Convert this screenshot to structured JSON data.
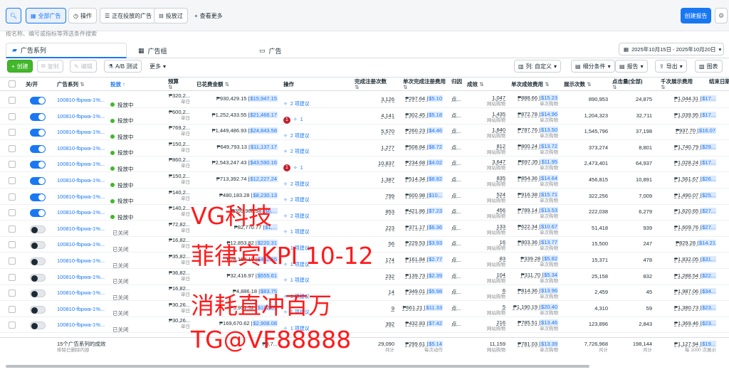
{
  "topbar": {
    "search_icon": "search-icon",
    "all_ads": "全部广告",
    "actions": "操作",
    "active_ads": "正在投放的广告",
    "delivered": "投放过",
    "more_views": "查看更多",
    "create_report": "创建报告"
  },
  "search": {
    "placeholder": "按名称、编号或指标等筛选条件搜索"
  },
  "tabs": {
    "campaigns": "广告系列",
    "adsets": "广告组",
    "ads": "广告"
  },
  "date_range": "2025年10月15日 - 2025年10月20日",
  "actions": {
    "create": "创建",
    "duplicate": "复制",
    "edit": "编辑",
    "ab_test": "A/B 测试",
    "more": "更多",
    "columns": "列: 自定义",
    "breakdown": "细分条件",
    "reports": "报告",
    "export": "导出",
    "charts": "图表"
  },
  "headers": {
    "onoff": "关/开",
    "campaign": "广告系列",
    "delivery": "投放",
    "budget": "预算",
    "spent": "已花费金额",
    "ops": "操作",
    "registrations": "完成注册次数",
    "cost_per_reg": "单次完成注册费用",
    "date": "归因",
    "results": "成效",
    "cost_per_result": "单次成效费用",
    "impressions": "展示次数",
    "clicks": "点击量(全部)",
    "cpm": "千次展示费用",
    "end": "结束日期"
  },
  "rows": [
    {
      "on": true,
      "name": "100810-fbpwa-1%...",
      "status": "投放中",
      "budget": "₱320,2...",
      "spent": "₱930,429.15 |",
      "spent_usd": "$15,947.15",
      "ops": "2 项建议",
      "badge": "",
      "reg": "3,126",
      "cpr": "₱297.64 |",
      "cpr_usd": "$5.10",
      "dt": "点...",
      "res": "1,047",
      "cpres": "₱888.66 |",
      "cpres_usd": "$15.23",
      "imp": "890,953",
      "clk": "24,875",
      "cpm": "₱1,044.31 |",
      "cpm_usd": "$17..."
    },
    {
      "on": true,
      "name": "100810-fbpwa-1%...",
      "status": "投放中",
      "budget": "₱600,2...",
      "spent": "₱1,252,433.55 |",
      "spent_usd": "$21,466.17",
      "ops": "1",
      "badge": "1",
      "reg": "4,141",
      "cpr": "₱302.45 |",
      "cpr_usd": "$5.18",
      "dt": "点...",
      "res": "1,435",
      "cpres": "₱872.78 |",
      "cpres_usd": "$14.96",
      "imp": "1,204,323",
      "clk": "32,711",
      "cpm": "₱1,039.95 |",
      "cpm_usd": "$17..."
    },
    {
      "on": true,
      "name": "100810-fbpwa-1%...",
      "status": "投放中",
      "budget": "₱769,2...",
      "spent": "₱1,449,486.93 |",
      "spent_usd": "$24,843.58",
      "ops": "2 项建议",
      "badge": "",
      "reg": "5,570",
      "cpr": "₱260.23 |",
      "cpr_usd": "$4.46",
      "dt": "点...",
      "res": "1,840",
      "cpres": "₱787.76 |",
      "cpres_usd": "$13.50",
      "imp": "1,545,796",
      "clk": "37,198",
      "cpm": "₱937.70 |",
      "cpm_usd": "$16.07"
    },
    {
      "on": true,
      "name": "100810-fbpwa-1%...",
      "status": "投放中",
      "budget": "₱150,2...",
      "spent": "₱649,793.13 |",
      "spent_usd": "$11,137.17",
      "ops": "2 项建议",
      "badge": "",
      "reg": "1,277",
      "cpr": "₱508.84 |",
      "cpr_usd": "$8.72",
      "dt": "点...",
      "res": "812",
      "cpres": "₱800.24 |",
      "cpres_usd": "$13.72",
      "imp": "373,274",
      "clk": "8,801",
      "cpm": "₱1,740.79 |",
      "cpm_usd": "$29..."
    },
    {
      "on": true,
      "name": "100810-fbpwa-1%...",
      "status": "投放中",
      "budget": "₱860,2...",
      "spent": "₱2,543,247.43 |",
      "spent_usd": "$43,590.16",
      "ops": "1",
      "badge": "1",
      "reg": "10,837",
      "cpr": "₱234.68 |",
      "cpr_usd": "$4.02",
      "dt": "点...",
      "res": "3,647",
      "cpres": "₱697.35 |",
      "cpres_usd": "$11.95",
      "imp": "2,473,401",
      "clk": "64,937",
      "cpm": "₱1,028.24 |",
      "cpm_usd": "$17..."
    },
    {
      "on": true,
      "name": "100810-fbpwa-1%...",
      "status": "投放中",
      "budget": "₱150,2...",
      "spent": "₱713,392.74 |",
      "spent_usd": "$12,227.24",
      "ops": "2 项建议",
      "badge": "",
      "reg": "1,387",
      "cpr": "₱514.34 |",
      "cpr_usd": "$8.82",
      "dt": "点...",
      "res": "835",
      "cpres": "₱854.36 |",
      "cpres_usd": "$14.64",
      "imp": "456,815",
      "clk": "10,891",
      "cpm": "₱1,561.67 |",
      "cpm_usd": "$26..."
    },
    {
      "on": true,
      "name": "100810-fbpwa-1%...",
      "status": "投放中",
      "budget": "₱140,2...",
      "spent": "₱480,183.28 |",
      "spent_usd": "$8,230.13",
      "ops": "2 项建议",
      "badge": "",
      "reg": "799",
      "cpr": "₱600.98 |",
      "cpr_usd": "$10...",
      "dt": "点...",
      "res": "524",
      "cpres": "₱916.38 |",
      "cpres_usd": "$15.71",
      "imp": "322,256",
      "clk": "7,009",
      "cpm": "₱1,490.07 |",
      "cpm_usd": "$25..."
    },
    {
      "on": true,
      "name": "100810-fbpwa-1%...",
      "status": "投放中",
      "budget": "₱140,2...",
      "spent": "₱359,968.38 |",
      "spent_usd": "$6,...",
      "ops": "2 项建议",
      "badge": "",
      "reg": "853",
      "cpr": "₱421.86 |",
      "cpr_usd": "$7.23",
      "dt": "点...",
      "res": "456",
      "cpres": "₱789.14 |",
      "cpres_usd": "$13.53",
      "imp": "222,038",
      "clk": "6,279",
      "cpm": "₱1,620.65 |",
      "cpm_usd": "$27..."
    },
    {
      "on": false,
      "name": "100810-fbpwa-1%...",
      "status": "已关闭",
      "budget": "₱72,82...",
      "spent": "₱82,770.77 |",
      "spent_usd": "$1,...",
      "ops": "1 项建议",
      "badge": "",
      "reg": "223",
      "cpr": "₱371.17 |",
      "cpr_usd": "$6.36",
      "dt": "点...",
      "res": "133",
      "cpres": "₱622.34 |",
      "cpres_usd": "$10.67",
      "imp": "51,418",
      "clk": "939",
      "cpm": "₱1,609.76 |",
      "cpm_usd": "$27..."
    },
    {
      "on": false,
      "name": "100810-fbpwa-1%...",
      "status": "已关闭",
      "budget": "₱16,82...",
      "spent": "₱12,853.82 |",
      "spent_usd": "$220.31",
      "ops": "1 项建议",
      "badge": "",
      "reg": "56",
      "cpr": "₱229.53 |",
      "cpr_usd": "$3.93",
      "dt": "点...",
      "res": "16",
      "cpres": "₱803.36 |",
      "cpres_usd": "$13.77",
      "imp": "15,500",
      "clk": "247",
      "cpm": "₱829.28 |",
      "cpm_usd": "$14.21"
    },
    {
      "on": false,
      "name": "100810-fbpwa-1%...",
      "status": "已关闭",
      "budget": "₱35,82...",
      "spent": "₱28,154.18 |",
      "spent_usd": "$482.55",
      "ops": "1 项建议",
      "badge": "",
      "reg": "174",
      "cpr": "₱161.84 |",
      "cpr_usd": "$2.77",
      "dt": "点...",
      "res": "83",
      "cpres": "₱339.28 |",
      "cpres_usd": "$5.82",
      "imp": "15,371",
      "clk": "478",
      "cpm": "₱1,832.05 |",
      "cpm_usd": "$31..."
    },
    {
      "on": false,
      "name": "100810-fbpwa-1%...",
      "status": "已关闭",
      "budget": "₱36,82...",
      "spent": "₱32,416.97 |",
      "spent_usd": "$555.61",
      "ops": "1 项建议",
      "badge": "",
      "reg": "232",
      "cpr": "₱139.73 |",
      "cpr_usd": "$2.39",
      "dt": "点...",
      "res": "104",
      "cpres": "₱311.70 |",
      "cpres_usd": "$5.34",
      "imp": "25,158",
      "clk": "832",
      "cpm": "₱1,288.54 |",
      "cpm_usd": "$22..."
    },
    {
      "on": false,
      "name": "100810-fbpwa-1%...",
      "status": "已关闭",
      "budget": "₱16,82...",
      "spent": "₱4,886.18 |",
      "spent_usd": "$83.75",
      "ops": "1 项建议",
      "badge": "",
      "reg": "14",
      "cpr": "₱349.01 |",
      "cpr_usd": "$5.98",
      "dt": "点...",
      "res": "6",
      "cpres": "₱814.36 |",
      "cpres_usd": "$13.96",
      "imp": "2,459",
      "clk": "45",
      "cpm": "₱1,987.06 |",
      "cpm_usd": "$34..."
    },
    {
      "on": false,
      "name": "100810-fbpwa-1%...",
      "status": "已关闭",
      "budget": "₱30,26...",
      "spent": "₱5,951.52 |",
      "spent_usd": "$102.01",
      "ops": "1 项建议",
      "badge": "",
      "reg": "9",
      "cpr": "₱661.21 |",
      "cpr_usd": "$11.33",
      "dt": "点...",
      "res": "5",
      "cpres": "₱1,190.19 |",
      "cpres_usd": "$20.40",
      "imp": "4,310",
      "clk": "59",
      "cpm": "₱1,380.73 |",
      "cpm_usd": "$23..."
    },
    {
      "on": false,
      "name": "100810-fbpwa-1%...",
      "status": "已关闭",
      "budget": "₱30,26...",
      "spent": "₱169,670.62 |",
      "spent_usd": "$2,908.08",
      "ops": "1 项建议",
      "badge": "",
      "reg": "392",
      "cpr": "₱432.83 |",
      "cpr_usd": "$7.42",
      "dt": "点...",
      "res": "216",
      "cpres": "₱785.51 |",
      "cpres_usd": "$13.46",
      "imp": "123,896",
      "clk": "2,843",
      "cpm": "₱1,369.46 |",
      "cpm_usd": "$23..."
    }
  ],
  "footer": {
    "label": "15个广告系列的成效",
    "sub": "排除已删除内容",
    "spent": "₱8,7...",
    "reg": "29,090",
    "reg_sub": "共计",
    "cpr": "₱299.61 |",
    "cpr_usd": "$5.14",
    "cpr_sub": "每次动作",
    "res": "11,159",
    "res_sub": "网站购物",
    "cpres": "₱781.03 |",
    "cpres_usd": "$13.39",
    "cpres_sub": "单次购物",
    "imp": "7,726,968",
    "imp_sub": "共计",
    "clk": "198,144",
    "clk_sub": "共计",
    "cpm": "₱1,127.94 |",
    "cpm_usd": "$19...",
    "cpm_sub": "每 1000 次展示"
  },
  "sub_labels": {
    "budget": "单日",
    "res": "网站购物",
    "cpres": "单次购物"
  },
  "watermark": {
    "line1": "VG科技",
    "line2": "菲律宾KPI  10-12",
    "line3": "消耗直冲百万",
    "line4": "TG@VF88888"
  }
}
